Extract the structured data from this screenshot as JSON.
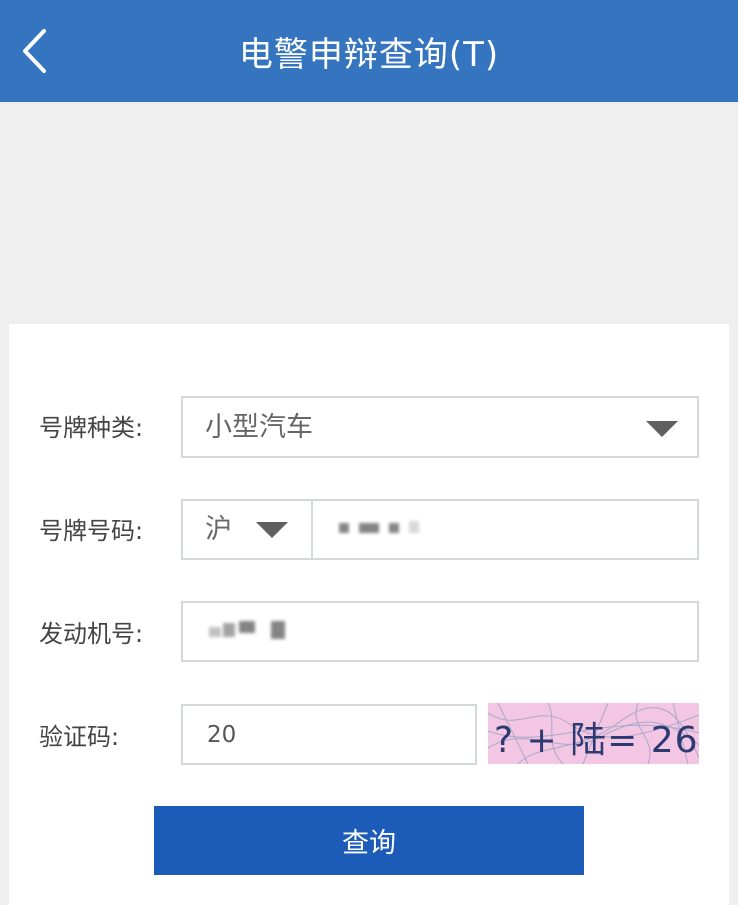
{
  "header": {
    "title": "电警申辩查询(T)",
    "back_icon": "chevron-left-icon",
    "background": "#3575c0"
  },
  "form": {
    "plate_type": {
      "label": "号牌种类:",
      "value": "小型汽车"
    },
    "plate_number": {
      "label": "号牌号码:",
      "province": "沪",
      "value": ""
    },
    "engine_number": {
      "label": "发动机号:",
      "value": ""
    },
    "captcha": {
      "label": "验证码:",
      "value": "20",
      "image_text": "? + 陆= 26"
    }
  },
  "submit_label": "查询",
  "colors": {
    "accent": "#1d5bb9",
    "captcha_bg": "#f3c6e4"
  }
}
